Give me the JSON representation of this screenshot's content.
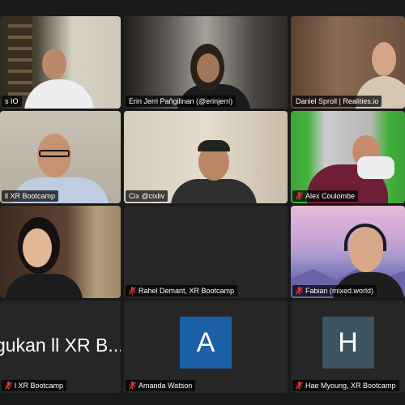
{
  "participants": [
    {
      "name": "s IO",
      "muted": false
    },
    {
      "name": "Erin Jerri Pañgilinan (@erinjerri)",
      "muted": false,
      "active_speaker": true
    },
    {
      "name": "Daniel Sproll | Realities.io",
      "muted": false
    },
    {
      "name": "ll XR Bootcamp",
      "muted": false
    },
    {
      "name": "Cix @cixliv",
      "muted": false
    },
    {
      "name": "Alex Coulombe",
      "muted": true
    },
    {
      "name": "",
      "muted": false
    },
    {
      "name": "Rahel Demant, XR Bootcamp",
      "muted": true
    },
    {
      "name": "Fabian (mixed.world)",
      "muted": true
    },
    {
      "name": "l XR Bootcamp",
      "muted": true,
      "display_text": "gukan ll XR B..."
    },
    {
      "name": "Amanda Watson",
      "muted": true,
      "avatar_letter": "A",
      "avatar_color": "#1a5fa8"
    },
    {
      "name": "Hae Myoung, XR Bootcamp",
      "muted": true,
      "avatar_letter": "H",
      "avatar_color": "#3c5560"
    }
  ],
  "colors": {
    "active_border": "#3ccf4e",
    "muted_icon": "#e0302f"
  }
}
